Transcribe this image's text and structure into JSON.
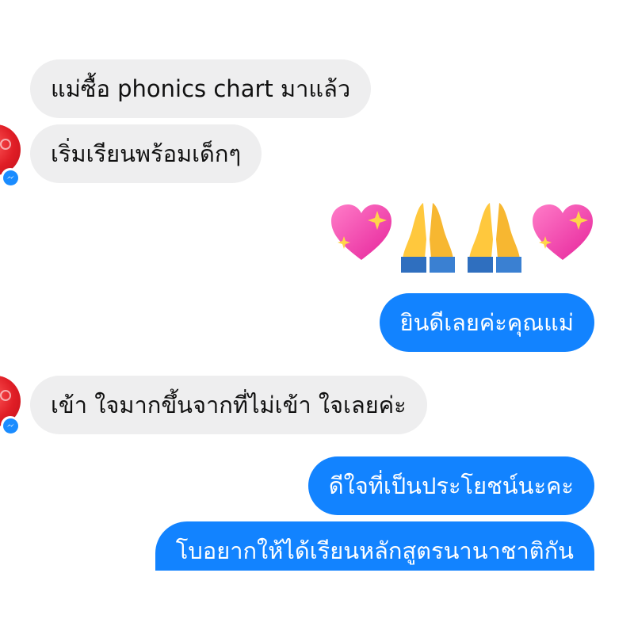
{
  "messages": [
    {
      "id": "m1",
      "direction": "received",
      "text": "แม่ซื้อ phonics chart มาแล้ว"
    },
    {
      "id": "m2",
      "direction": "received",
      "text": "เริ่มเรียนพร้อมเด็กๆ"
    },
    {
      "id": "m3",
      "direction": "sent",
      "emojis": [
        "sparkling-heart",
        "folded-hands",
        "folded-hands",
        "sparkling-heart"
      ]
    },
    {
      "id": "m4",
      "direction": "sent",
      "text": "ยินดีเลยค่ะคุณแม่"
    },
    {
      "id": "m5",
      "direction": "received",
      "text": "เข้า ใจมากขึ้นจากที่ไม่เข้า ใจเลยค่ะ"
    },
    {
      "id": "m6",
      "direction": "sent",
      "text": "ดีใจที่เป็นประโยชน์นะคะ"
    },
    {
      "id": "m7",
      "direction": "sent",
      "text": "โบอยากให้ได้เรียนหลักสูตรนานาชาติกัน"
    }
  ],
  "colors": {
    "sent_bubble": "#1283ff",
    "received_bubble": "#eeeeef",
    "avatar": "#e01e26",
    "messenger_badge": "#1a8cff"
  },
  "icons": {
    "sender_avatar": "avatar",
    "app_badge": "messenger-badge-icon",
    "reaction_emojis": [
      "sparkling-heart-icon",
      "folded-hands-icon"
    ]
  }
}
